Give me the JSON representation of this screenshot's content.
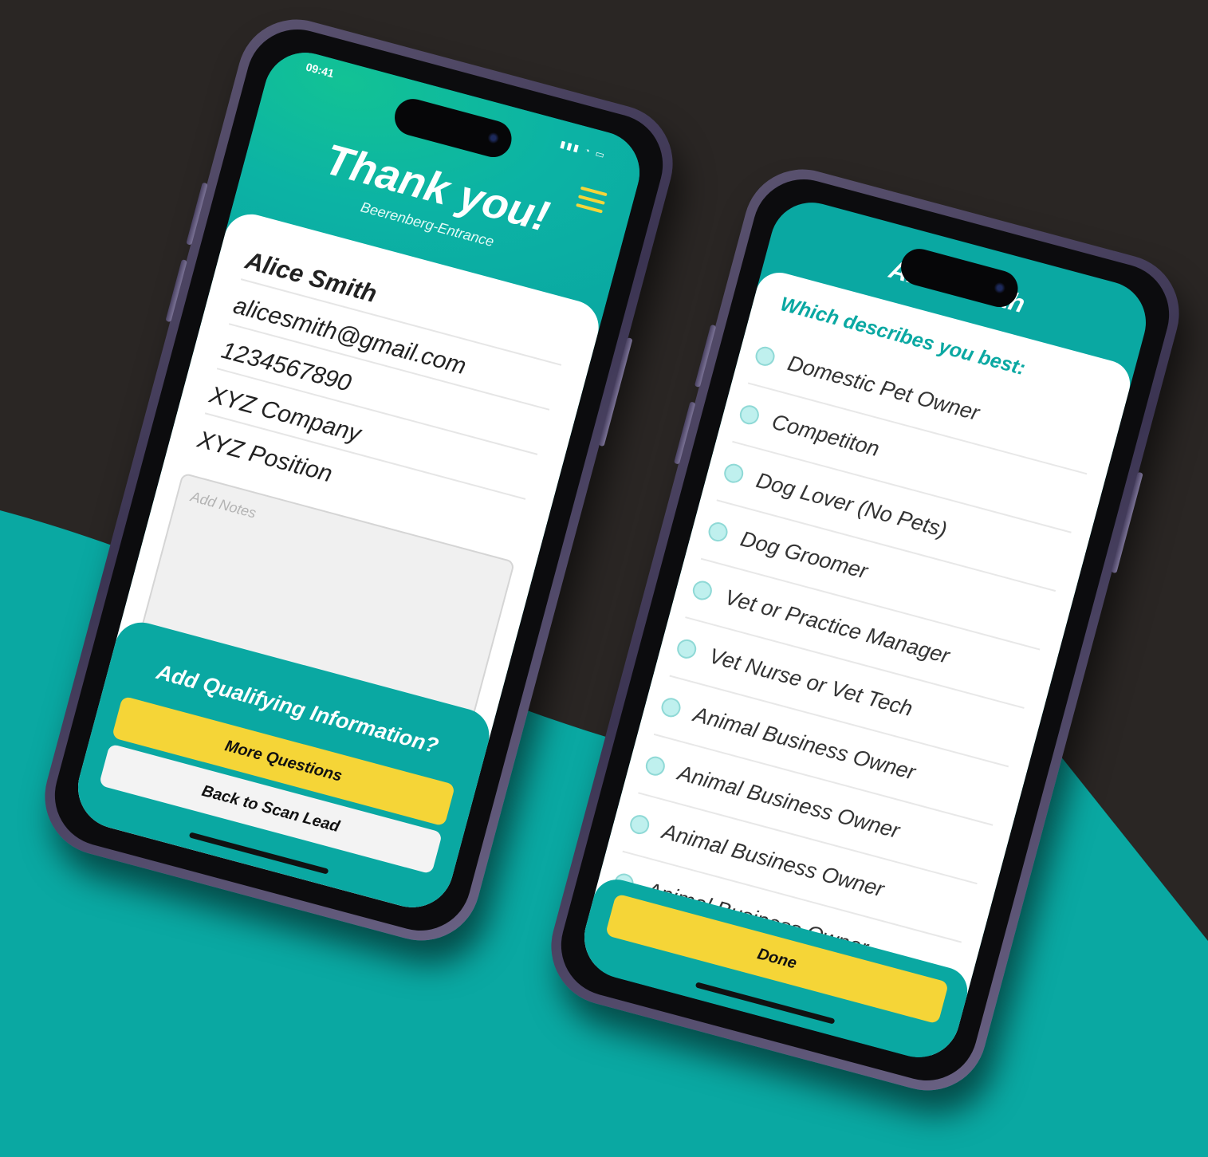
{
  "colors": {
    "background": "#2a2624",
    "teal": "#0aa8a2",
    "yellow": "#f5d537",
    "white": "#ffffff"
  },
  "phone1": {
    "status_time": "09:41",
    "title": "Thank you!",
    "subtitle": "Beerenberg-Entrance",
    "menu_icon": "hamburger-menu-icon",
    "fields": {
      "name": "Alice Smith",
      "email": "alicesmith@gmail.com",
      "phone": "1234567890",
      "company": "XYZ Company",
      "position": "XYZ Position"
    },
    "notes": {
      "placeholder": "Add Notes",
      "value": ""
    },
    "qualifying_prompt": "Add Qualifying Information?",
    "buttons": {
      "more_questions": "More Questions",
      "back_to_scan": "Back to Scan Lead"
    }
  },
  "phone2": {
    "header_title": "Alice Smith",
    "question": "Which describes you best:",
    "options": [
      "Domestic Pet Owner",
      "Competiton",
      "Dog Lover (No Pets)",
      "Dog Groomer",
      "Vet or Practice Manager",
      "Vet Nurse or Vet Tech",
      "Animal Business Owner",
      "Animal Business Owner",
      "Animal Business Owner",
      "Animal Business Owner"
    ],
    "done_label": "Done"
  }
}
